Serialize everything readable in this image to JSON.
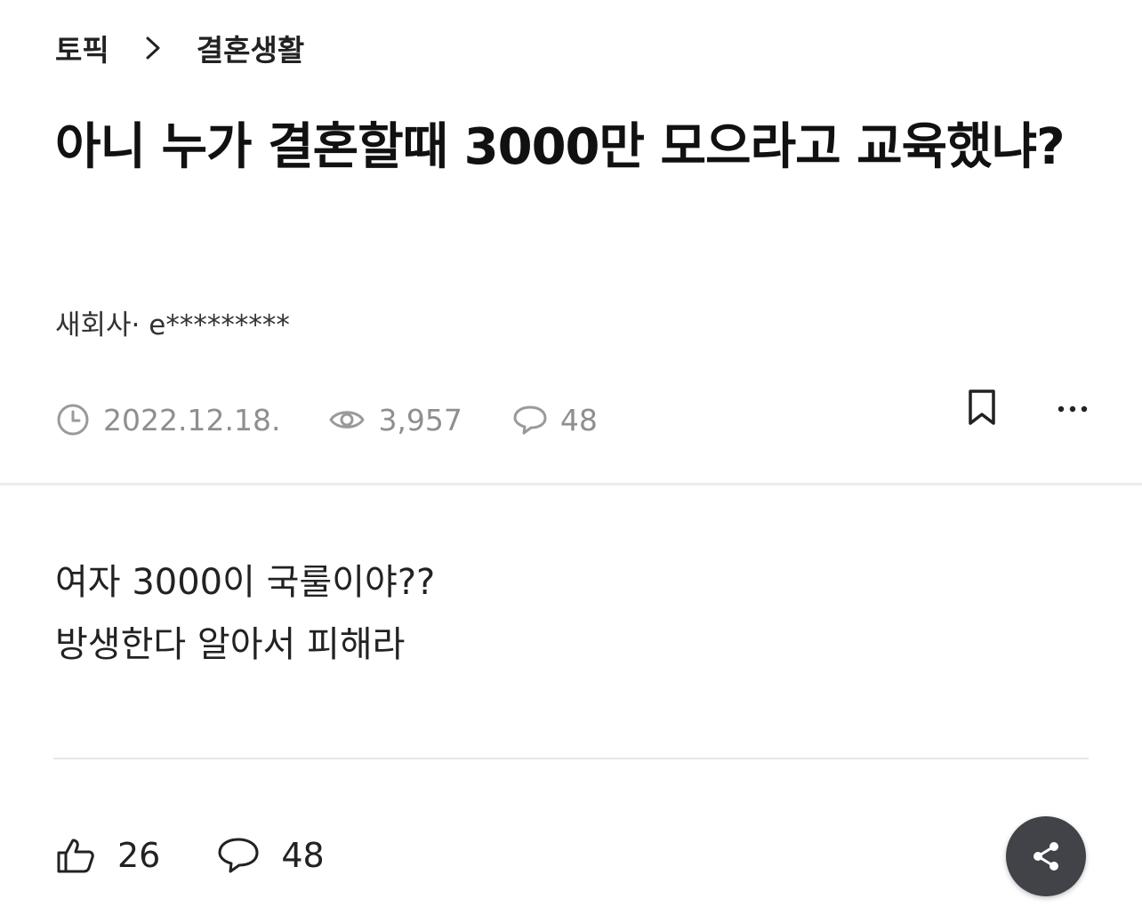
{
  "breadcrumb": {
    "root": "토픽",
    "current": "결혼생활",
    "separator_icon": "chevron-right-icon"
  },
  "post": {
    "title": "아니 누가 결혼할때 3000만 모으라고 교육했냐?",
    "author": "새회사· e*********",
    "date": "2022.12.18.",
    "views": "3,957",
    "comment_count": "48",
    "body": [
      "여자 3000이 국룰이야??",
      "방생한다 알아서 피해라"
    ],
    "likes": "26",
    "comments_footer": "48"
  },
  "icons": {
    "date": "clock-icon",
    "views": "eye-icon",
    "comments": "speech-bubble-icon",
    "bookmark": "bookmark-icon",
    "more": "more-dots-icon",
    "like": "thumbs-up-icon",
    "share": "share-icon"
  },
  "colors": {
    "text_primary": "#111111",
    "text_muted": "#8f8f8f",
    "divider": "#ececec",
    "share_button_bg": "#414349"
  }
}
